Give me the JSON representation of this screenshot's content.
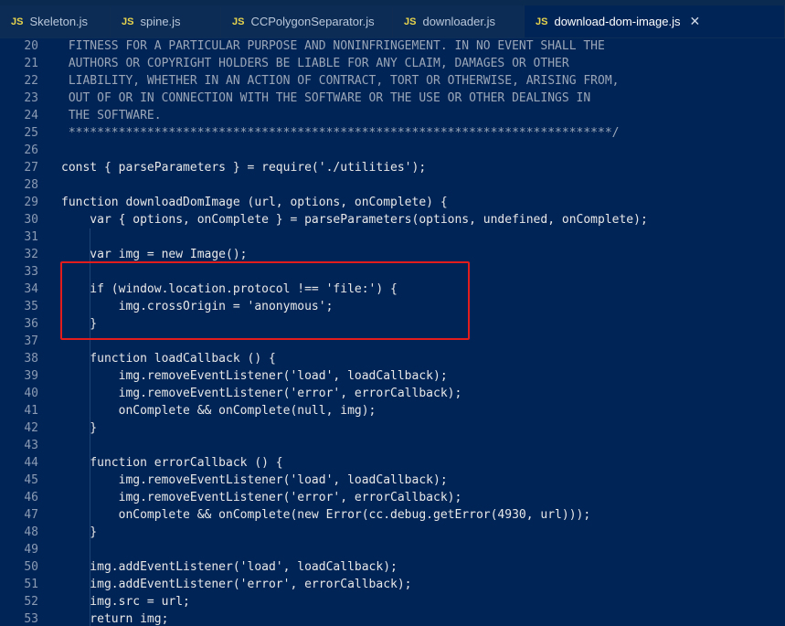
{
  "tabs": [
    {
      "icon": "JS",
      "label": "Skeleton.js",
      "active": false
    },
    {
      "icon": "JS",
      "label": "spine.js",
      "active": false
    },
    {
      "icon": "JS",
      "label": "CCPolygonSeparator.js",
      "active": false
    },
    {
      "icon": "JS",
      "label": "downloader.js",
      "active": false
    },
    {
      "icon": "JS",
      "label": "download-dom-image.js",
      "active": true
    }
  ],
  "close_glyph": "✕",
  "lines": [
    {
      "n": "20",
      "t": " FITNESS FOR A PARTICULAR PURPOSE AND NONINFRINGEMENT. IN NO EVENT SHALL THE"
    },
    {
      "n": "21",
      "t": " AUTHORS OR COPYRIGHT HOLDERS BE LIABLE FOR ANY CLAIM, DAMAGES OR OTHER"
    },
    {
      "n": "22",
      "t": " LIABILITY, WHETHER IN AN ACTION OF CONTRACT, TORT OR OTHERWISE, ARISING FROM,"
    },
    {
      "n": "23",
      "t": " OUT OF OR IN CONNECTION WITH THE SOFTWARE OR THE USE OR OTHER DEALINGS IN"
    },
    {
      "n": "24",
      "t": " THE SOFTWARE."
    },
    {
      "n": "25",
      "t": " ****************************************************************************/"
    },
    {
      "n": "26",
      "t": ""
    },
    {
      "n": "27",
      "t": "const { parseParameters } = require('./utilities');"
    },
    {
      "n": "28",
      "t": ""
    },
    {
      "n": "29",
      "t": "function downloadDomImage (url, options, onComplete) {"
    },
    {
      "n": "30",
      "t": "    var { options, onComplete } = parseParameters(options, undefined, onComplete);"
    },
    {
      "n": "31",
      "t": ""
    },
    {
      "n": "32",
      "t": "    var img = new Image();"
    },
    {
      "n": "33",
      "t": ""
    },
    {
      "n": "34",
      "t": "    if (window.location.protocol !== 'file:') {"
    },
    {
      "n": "35",
      "t": "        img.crossOrigin = 'anonymous';"
    },
    {
      "n": "36",
      "t": "    }"
    },
    {
      "n": "37",
      "t": ""
    },
    {
      "n": "38",
      "t": "    function loadCallback () {"
    },
    {
      "n": "39",
      "t": "        img.removeEventListener('load', loadCallback);"
    },
    {
      "n": "40",
      "t": "        img.removeEventListener('error', errorCallback);"
    },
    {
      "n": "41",
      "t": "        onComplete && onComplete(null, img);"
    },
    {
      "n": "42",
      "t": "    }"
    },
    {
      "n": "43",
      "t": ""
    },
    {
      "n": "44",
      "t": "    function errorCallback () {"
    },
    {
      "n": "45",
      "t": "        img.removeEventListener('load', loadCallback);"
    },
    {
      "n": "46",
      "t": "        img.removeEventListener('error', errorCallback);"
    },
    {
      "n": "47",
      "t": "        onComplete && onComplete(new Error(cc.debug.getError(4930, url)));"
    },
    {
      "n": "48",
      "t": "    }"
    },
    {
      "n": "49",
      "t": ""
    },
    {
      "n": "50",
      "t": "    img.addEventListener('load', loadCallback);"
    },
    {
      "n": "51",
      "t": "    img.addEventListener('error', errorCallback);"
    },
    {
      "n": "52",
      "t": "    img.src = url;"
    },
    {
      "n": "53",
      "t": "    return img;"
    }
  ],
  "colors": {
    "background": "#012456",
    "highlight_box": "#e31c1c",
    "js_icon": "#e8d44d"
  }
}
